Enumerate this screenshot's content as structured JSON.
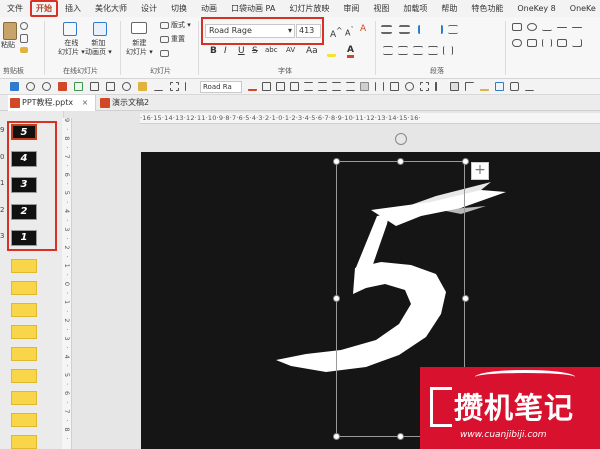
{
  "menu": {
    "items": [
      {
        "label": "文件",
        "active": false
      },
      {
        "label": "开始",
        "active": true
      },
      {
        "label": "插入",
        "active": false
      },
      {
        "label": "美化大师",
        "active": false
      },
      {
        "label": "设计",
        "active": false
      },
      {
        "label": "切换",
        "active": false
      },
      {
        "label": "动画",
        "active": false
      },
      {
        "label": "口袋动画 PA",
        "active": false
      },
      {
        "label": "幻灯片放映",
        "active": false
      },
      {
        "label": "审阅",
        "active": false
      },
      {
        "label": "视图",
        "active": false
      },
      {
        "label": "加载项",
        "active": false
      },
      {
        "label": "帮助",
        "active": false
      },
      {
        "label": "特色功能",
        "active": false
      },
      {
        "label": "OneKey 8",
        "active": false
      },
      {
        "label": "OneKe",
        "active": false
      }
    ]
  },
  "ribbon": {
    "paste_label": "粘贴",
    "clipboard_group": "剪贴板",
    "online_slides_label": "在线\n幻灯片",
    "new_animation_label": "新加\n动画页",
    "online_group": "在线幻灯片",
    "new_slide_label": "新建\n幻灯片",
    "layout_label": "版式",
    "reset_label": "重置",
    "slides_group": "幻灯片",
    "font_name": "Road Rage",
    "font_size": "413",
    "font_group": "字体",
    "paragraph_group": "段落",
    "bold": "B",
    "italic": "I",
    "underline": "U",
    "strike": "S",
    "shadow": "abc",
    "spacing": "AV",
    "case": "Aa",
    "font_color": "A"
  },
  "quickbar": {
    "font_name": "Road Ra"
  },
  "tabs": [
    {
      "label": "PPT教程.pptx",
      "close": "×",
      "active": true
    },
    {
      "label": "演示文稿2",
      "close": "",
      "active": false
    }
  ],
  "thumbnails": {
    "numbers": [
      "9",
      "0",
      "1",
      "2",
      "3"
    ],
    "digits": [
      "5",
      "4",
      "3",
      "2",
      "1"
    ]
  },
  "ruler": {
    "horizontal": "·16·15·14·13·12·11·10·9·8·7·6·5·4·3·2·1·0·1·2·3·4·5·6·7·8·9·10·11·12·13·14·15·16·",
    "vertical": "9·8·7·6·5·4·3·2·1·0·1·2·3·4·5·6·7·8·9"
  },
  "slide": {
    "big_digit": "5",
    "plus": "+"
  },
  "watermark": {
    "title": "攒机笔记",
    "url": "www.cuanjibiji.com"
  },
  "colors": {
    "accent": "#b7472a",
    "highlight_box": "#d93025",
    "slide_bg": "#151515",
    "watermark_bg": "#d8122e",
    "thumb_yellow": "#f9d54a"
  }
}
